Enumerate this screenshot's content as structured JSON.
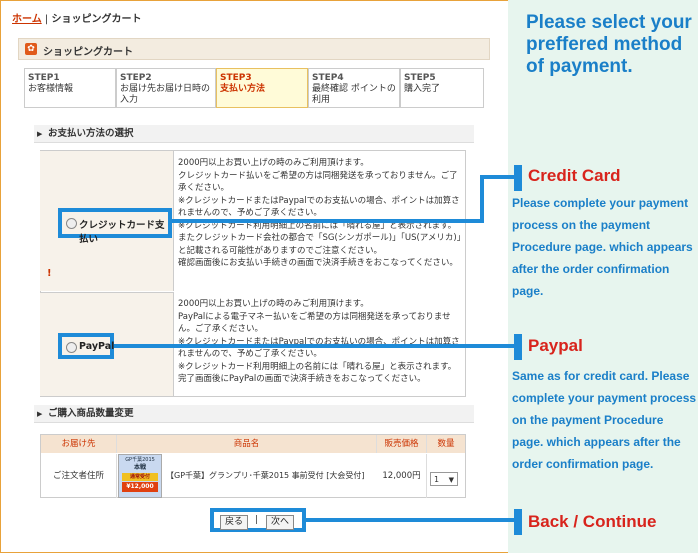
{
  "breadcrumb": {
    "home": "ホーム",
    "sep": "|",
    "current": "ショッピングカート"
  },
  "panel": {
    "title": "ショッピングカート"
  },
  "steps": [
    {
      "num": "STEP1",
      "label": "お客様情報",
      "active": false
    },
    {
      "num": "STEP2",
      "label": "お届け先お届け日時の入力",
      "active": false
    },
    {
      "num": "STEP3",
      "label": "支払い方法",
      "active": true
    },
    {
      "num": "STEP4",
      "label": "最終確認 ポイントの利用",
      "active": false
    },
    {
      "num": "STEP5",
      "label": "購入完了",
      "active": false
    }
  ],
  "payment_section": {
    "title": "お支払い方法の選択",
    "options": [
      {
        "label": "クレジットカード支払い",
        "lines": [
          "2000円以上お買い上げの時のみご利用頂けます。",
          "クレジットカード払いをご希望の方は同梱発送を承っておりません。ご了承ください。",
          "※クレジットカードまたはPaypalでのお支払いの場合、ポイントは加算されませんので、予めご了承ください。",
          "※クレジットカード利用明細上の名前には「晴れる屋」と表示されます。またクレジットカード会社の都合で「SG(シンガポール)」「US(アメリカ)」と記載される可能性がありますのでご注意ください。",
          "確認画面後にお支払い手続きの画面で決済手続きをおこなってください。"
        ]
      },
      {
        "label": "PayPal",
        "lines": [
          "2000円以上お買い上げの時のみご利用頂けます。",
          "PayPalによる電子マネー払いをご希望の方は同梱発送を承っておりません。ご了承ください。",
          "※クレジットカードまたはPaypalでのお支払いの場合、ポイントは加算されませんので、予めご了承ください。",
          "※クレジットカード利用明細上の名前には「晴れる屋」と表示されます。",
          "完了画面後にPayPalの画面で決済手続きをおこなってください。"
        ]
      }
    ],
    "warning_mark": "!"
  },
  "order_section": {
    "title": "ご購入商品数量変更",
    "headers": [
      "お届け先",
      "商品名",
      "販売価格",
      "数量"
    ],
    "row": {
      "destination": "ご注文者住所",
      "product": "【GP千葉】グランプリ･千葉2015 事前受付 [大会受付]",
      "price": "12,000円",
      "qty": "1"
    },
    "thumb": {
      "line1": "GP千葉2015",
      "line2": "本戦",
      "badge": "通常受付",
      "price": "¥12,000"
    }
  },
  "buttons": {
    "back": "戻る",
    "sep": "|",
    "next": "次へ"
  },
  "annotations": {
    "title": "Please select your preffered method of payment.",
    "credit_heading": "Credit Card",
    "credit_note": "Please complete your payment process on the payment Procedure page. which appears after the order confirmation page.",
    "paypal_heading": "Paypal",
    "paypal_note": "Same as for credit card. Please complete your payment process on the payment Procedure page. which appears after the order confirmation page.",
    "nav_heading": "Back / Continue"
  },
  "colors": {
    "highlight": "#1e8bd8",
    "heading_red": "#d8241c",
    "note_blue": "#1a7fc8",
    "panel_bg": "#e7f5ee"
  }
}
